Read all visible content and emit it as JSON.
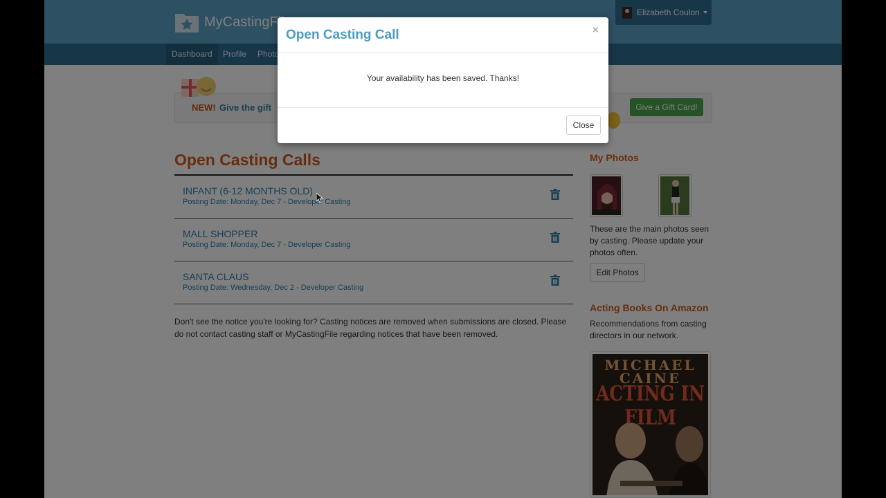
{
  "header": {
    "brand": "MyCastingFile",
    "user_name": "Elizabeth Coulon"
  },
  "nav": {
    "items": [
      "Dashboard",
      "Profile",
      "Photo"
    ]
  },
  "promo": {
    "new_label": "NEW!",
    "text": "Give the gift",
    "button": "Give a Gift Card!"
  },
  "main": {
    "title": "Open Casting Calls",
    "calls": [
      {
        "title": "INFANT (6-12 MONTHS OLD)",
        "meta": "Posting Date: Monday, Dec 7 - Developer Casting"
      },
      {
        "title": "MALL SHOPPER",
        "meta": "Posting Date: Monday, Dec 7 - Developer Casting"
      },
      {
        "title": "SANTA CLAUS",
        "meta": "Posting Date: Wednesday, Dec 2 - Developer Casting"
      }
    ],
    "footer_note": "Don't see the notice you're looking for? Casting notices are removed when submissions are closed. Please do not contact casting staff or MyCastingFile regarding notices that have been removed."
  },
  "sidebar": {
    "photos_title": "My Photos",
    "photos_text": "These are the main photos seen by casting. Please update your photos often.",
    "edit_button": "Edit Photos",
    "books_title": "Acting Books On Amazon",
    "books_text": "Recommendations from casting directors in our network.",
    "book_cover": {
      "line1": "MICHAEL",
      "line2": "CAINE",
      "line3": "ACTING IN FILM"
    }
  },
  "modal": {
    "title": "Open Casting Call",
    "close_x": "×",
    "message": "Your availability has been saved. Thanks!",
    "close_button": "Close"
  },
  "colors": {
    "header": "#5aa0c4",
    "navbar": "#2f6f92",
    "accent_orange": "#d15a1a",
    "link_blue": "#2f7dab",
    "gift_green": "#4ca64c"
  }
}
